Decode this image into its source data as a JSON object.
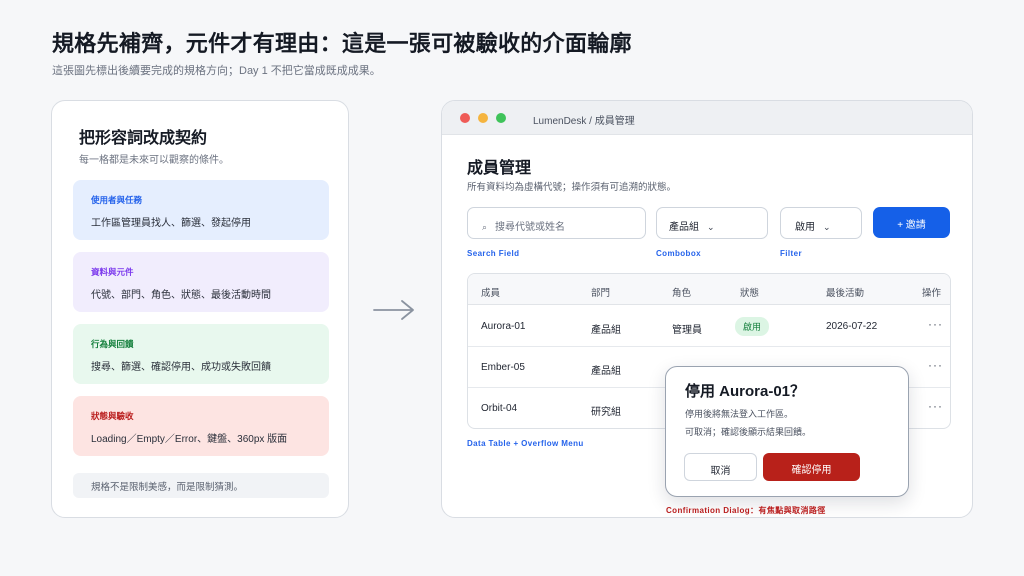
{
  "header": {
    "title": "規格先補齊，元件才有理由：這是一張可被驗收的介面輪廓",
    "subtitle": "這張圖先標出後續要完成的規格方向；Day 1 不把它當成既成成果。"
  },
  "contract_card": {
    "title": "把形容詞改成契約",
    "subtitle": "每一格都是未來可以觀察的條件。",
    "blocks": [
      {
        "label": "使用者與任務",
        "text": "工作區管理員找人、篩選、發起停用"
      },
      {
        "label": "資料與元件",
        "text": "代號、部門、角色、狀態、最後活動時間"
      },
      {
        "label": "行為與回饋",
        "text": "搜尋、篩選、確認停用、成功或失敗回饋"
      },
      {
        "label": "狀態與驗收",
        "text": "Loading／Empty／Error、鍵盤、360px 版面"
      }
    ],
    "note": "規格不是限制美感，而是限制猜測。"
  },
  "window": {
    "title": "LumenDesk / 成員管理",
    "page_title": "成員管理",
    "page_subtitle": "所有資料均為虛構代號；操作須有可追溯的狀態。",
    "search_placeholder": "搜尋代號或姓名",
    "combo_value": "產品組",
    "filter_value": "啟用",
    "invite_label": "+ 邀請",
    "tags": {
      "search": "Search Field",
      "combo": "Combobox",
      "filter": "Filter",
      "table": "Data Table + Overflow Menu",
      "dialog": "Confirmation Dialog：有焦點與取消路徑"
    },
    "table": {
      "columns": [
        "成員",
        "部門",
        "角色",
        "狀態",
        "最後活動",
        "操作"
      ],
      "rows": [
        {
          "member": "Aurora-01",
          "dept": "產品組",
          "role": "管理員",
          "status": "啟用",
          "last": "2026-07-22",
          "action": "···"
        },
        {
          "member": "Ember-05",
          "dept": "產品組",
          "role": "",
          "status": "",
          "last": "",
          "action": "···"
        },
        {
          "member": "Orbit-04",
          "dept": "研究組",
          "role": "",
          "status": "",
          "last": "",
          "action": "···"
        }
      ]
    }
  },
  "dialog": {
    "title": "停用 Aurora-01？",
    "line1": "停用後將無法登入工作區。",
    "line2": "可取消；確認後顯示結果回饋。",
    "cancel_label": "取消",
    "confirm_label": "確認停用"
  },
  "colors": {
    "accent_blue": "#1560e8",
    "danger_red": "#b8211a",
    "success_green": "#15803d"
  },
  "icons": [
    "search-icon",
    "chevron-down-icon",
    "arrow-right-icon",
    "more-icon"
  ]
}
